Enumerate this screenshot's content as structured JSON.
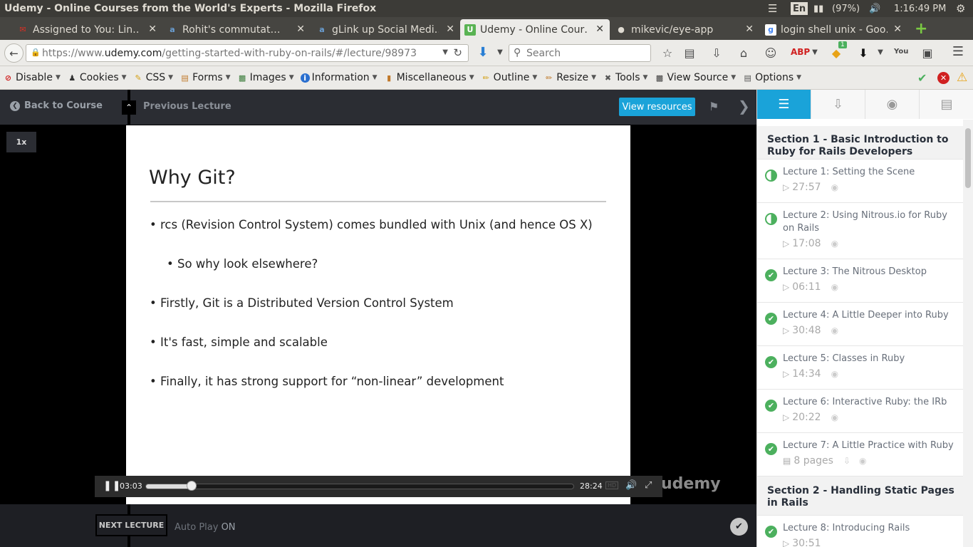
{
  "os": {
    "window_title": "Udemy - Online Courses from the World's Experts - Mozilla Firefox",
    "lang": "En",
    "battery": "(97%)",
    "clock": "1:16:49 PM"
  },
  "tabs": [
    {
      "label": "Assigned to You: Lin…",
      "icon": "gmail-icon"
    },
    {
      "label": "Rohit's commutat…",
      "icon": "page-icon"
    },
    {
      "label": "gLink up Social Medi…",
      "icon": "page-icon"
    },
    {
      "label": "Udemy - Online Cour…",
      "icon": "udemy-icon"
    },
    {
      "label": "mikevic/eye-app",
      "icon": "github-icon"
    },
    {
      "label": "login shell unix - Goo…",
      "icon": "google-icon"
    }
  ],
  "nav": {
    "url_prefix": "https://www.",
    "url_domain": "udemy.com",
    "url_path": "/getting-started-with-ruby-on-rails/#/lecture/98973",
    "search_placeholder": "Search",
    "badge_count": "1"
  },
  "webdev": [
    {
      "label": "Disable",
      "icon": "disable-icon",
      "color": "#d02020"
    },
    {
      "label": "Cookies",
      "icon": "cookies-icon",
      "color": "#333333"
    },
    {
      "label": "CSS",
      "icon": "css-icon",
      "color": "#d4a017"
    },
    {
      "label": "Forms",
      "icon": "forms-icon",
      "color": "#c0792a"
    },
    {
      "label": "Images",
      "icon": "images-icon",
      "color": "#3c7d3c"
    },
    {
      "label": "Information",
      "icon": "information-icon",
      "color": "#2a6fcf"
    },
    {
      "label": "Miscellaneous",
      "icon": "miscellaneous-icon",
      "color": "#c0792a"
    },
    {
      "label": "Outline",
      "icon": "outline-icon",
      "color": "#d4a017"
    },
    {
      "label": "Resize",
      "icon": "resize-icon",
      "color": "#c0792a"
    },
    {
      "label": "Tools",
      "icon": "tools-icon",
      "color": "#555555"
    },
    {
      "label": "View Source",
      "icon": "view-source-icon",
      "color": "#3c3c3c"
    },
    {
      "label": "Options",
      "icon": "options-icon",
      "color": "#555555"
    }
  ],
  "player": {
    "back_label": "Back to Course",
    "prev_label": "Previous Lecture",
    "resources_label": "View resources",
    "speed": "1x",
    "current_time": "03:03",
    "duration": "28:24",
    "hd": "HD",
    "progress": 0.107,
    "watermark": "udemy",
    "next_label": "NEXT LECTURE",
    "autoplay_label": "Auto Play",
    "autoplay_state": "ON",
    "accent": "#1aa3d9"
  },
  "slide": {
    "title": "Why Git?",
    "bullets": [
      "rcs (Revision Control System) comes bundled with Unix (and hence OS X)",
      "So why look elsewhere?",
      "Firstly, Git is a Distributed Version Control System",
      "It's fast, simple and scalable",
      "Finally, it has strong support for “non-linear” development"
    ]
  },
  "sidebar": {
    "sections": [
      {
        "title": "Section 1 - Basic Introduction to Ruby for Rails Developers"
      },
      {
        "title": "Section 2 - Handling Static Pages in Rails"
      }
    ],
    "lectures": [
      {
        "title": "Lecture 1: Setting the Scene",
        "meta": "27:57",
        "status": "partial"
      },
      {
        "title": "Lecture 2: Using Nitrous.io for Ruby on Rails",
        "meta": "17:08",
        "status": "partial"
      },
      {
        "title": "Lecture 3: The Nitrous Desktop",
        "meta": "06:11",
        "status": "done"
      },
      {
        "title": "Lecture 4: A Little Deeper into Ruby",
        "meta": "30:48",
        "status": "done"
      },
      {
        "title": "Lecture 5: Classes in Ruby",
        "meta": "14:34",
        "status": "done"
      },
      {
        "title": "Lecture 6: Interactive Ruby: the IRb",
        "meta": "20:22",
        "status": "done"
      },
      {
        "title": "Lecture 7: A Little Practice with Ruby",
        "meta": "8 pages",
        "status": "done"
      },
      {
        "title": "Lecture 8: Introducing Rails",
        "meta": "30:51",
        "status": "done"
      }
    ]
  }
}
